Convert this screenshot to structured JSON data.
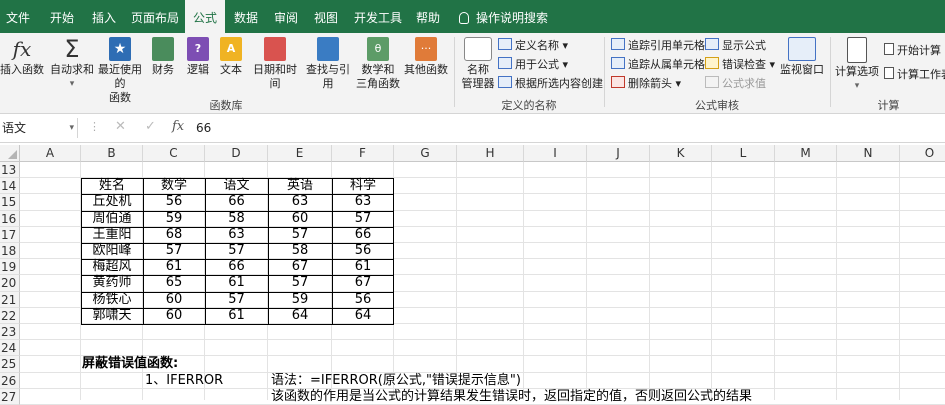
{
  "tabs": [
    "文件",
    "开始",
    "插入",
    "页面布局",
    "公式",
    "数据",
    "审阅",
    "视图",
    "开发工具",
    "帮助",
    "操作说明搜索"
  ],
  "ribbon": {
    "insert_function": "插入函数",
    "autosum": "自动求和",
    "recent_line1": "最近使用的",
    "recent_line2": "函数",
    "financial": "财务",
    "logical": "逻辑",
    "text": "文本",
    "datetime": "日期和时间",
    "lookup": "查找与引用",
    "math_line1": "数学和",
    "math_line2": "三角函数",
    "other": "其他函数",
    "group_library": "函数库",
    "name_manager_line1": "名称",
    "name_manager_line2": "管理器",
    "define_name": "定义名称",
    "use_in_formula": "用于公式",
    "create_from_selection": "根据所选内容创建",
    "group_defined_names": "定义的名称",
    "trace_precedents": "追踪引用单元格",
    "trace_dependents": "追踪从属单元格",
    "remove_arrows": "删除箭头",
    "show_formulas": "显示公式",
    "error_checking": "错误检查",
    "evaluate_formula": "公式求值",
    "watch_window": "监视窗口",
    "group_auditing": "公式审核",
    "calc_options": "计算选项",
    "calc_now": "开始计算",
    "calc_sheet": "计算工作表",
    "group_calculation": "计算"
  },
  "formula_bar": {
    "name_box": "语文",
    "value": "66",
    "fx": "fx"
  },
  "columns": [
    "A",
    "B",
    "C",
    "D",
    "E",
    "F",
    "G",
    "H",
    "I",
    "J",
    "K",
    "L",
    "M",
    "N",
    "O"
  ],
  "rows": [
    "13",
    "14",
    "15",
    "16",
    "17",
    "18",
    "19",
    "20",
    "21",
    "22",
    "23",
    "24",
    "25",
    "26",
    "27"
  ],
  "table": {
    "headers": [
      "姓名",
      "数学",
      "语文",
      "英语",
      "科学"
    ],
    "rows": [
      [
        "丘处机",
        "56",
        "66",
        "63",
        "63"
      ],
      [
        "周伯通",
        "59",
        "58",
        "60",
        "57"
      ],
      [
        "王重阳",
        "68",
        "63",
        "57",
        "66"
      ],
      [
        "欧阳峰",
        "57",
        "57",
        "58",
        "56"
      ],
      [
        "梅超风",
        "61",
        "66",
        "67",
        "61"
      ],
      [
        "黄药师",
        "65",
        "61",
        "57",
        "67"
      ],
      [
        "杨铁心",
        "60",
        "57",
        "59",
        "56"
      ],
      [
        "郭啸天",
        "60",
        "61",
        "64",
        "64"
      ]
    ]
  },
  "notes": {
    "heading": "屏蔽错误值函数:",
    "item": "1、IFERROR",
    "syntax": "语法：=IFERROR(原公式,\"错误提示信息\")",
    "desc": "该函数的作用是当公式的计算结果发生错误时，返回指定的值，否则返回公式的结果"
  },
  "colors": {
    "brand": "#217346",
    "ribbon_bg": "#f3f3f3"
  }
}
